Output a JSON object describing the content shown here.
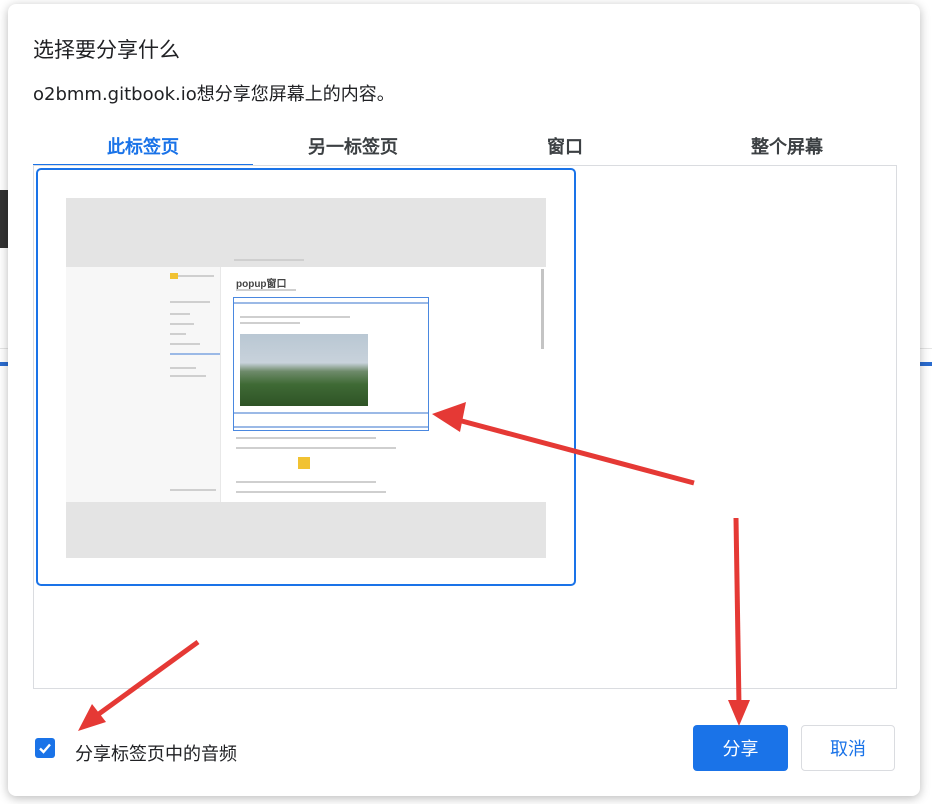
{
  "dialog": {
    "title": "选择要分享什么",
    "subtitle": "o2bmm.gitbook.io想分享您屏幕上的内容。"
  },
  "tabs": [
    {
      "label": "此标签页",
      "active": true
    },
    {
      "label": "另一标签页",
      "active": false
    },
    {
      "label": "窗口",
      "active": false
    },
    {
      "label": "整个屏幕",
      "active": false
    }
  ],
  "preview": {
    "page_title": "popup窗口"
  },
  "footer": {
    "share_audio_label": "分享标签页中的音频",
    "share_audio_checked": true,
    "share_button": "分享",
    "cancel_button": "取消"
  },
  "colors": {
    "accent": "#1a73e8",
    "annotation_arrow": "#e53935"
  }
}
